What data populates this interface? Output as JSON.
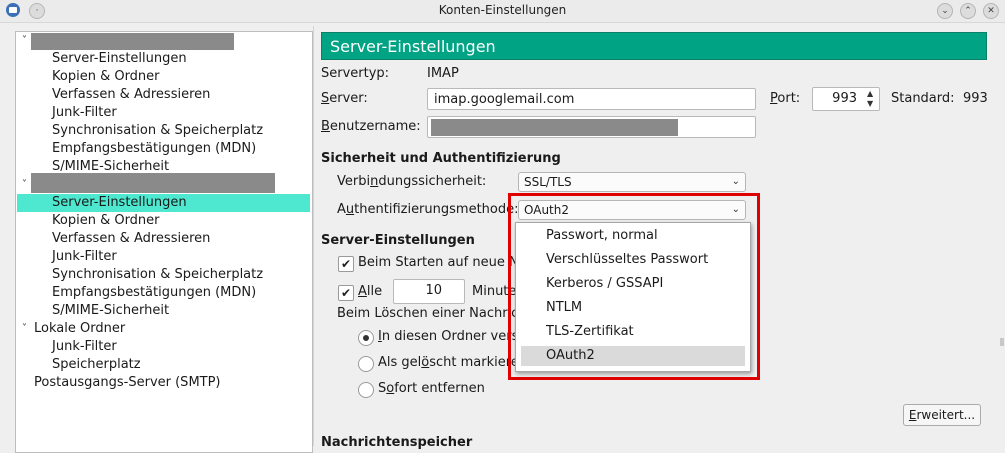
{
  "window": {
    "title": "Konten-Einstellungen",
    "buttons": {
      "minimize": "–",
      "maximize": "⌃",
      "close": "✕"
    }
  },
  "tree": {
    "account1": {
      "expanded_icon": "˅",
      "items": [
        "Server-Einstellungen",
        "Kopien & Ordner",
        "Verfassen & Adressieren",
        "Junk-Filter",
        "Synchronisation & Speicherplatz",
        "Empfangsbestätigungen (MDN)",
        "S/MIME-Sicherheit"
      ]
    },
    "account2": {
      "expanded_icon": "˅",
      "items": [
        "Server-Einstellungen",
        "Kopien & Ordner",
        "Verfassen & Adressieren",
        "Junk-Filter",
        "Synchronisation & Speicherplatz",
        "Empfangsbestätigungen (MDN)",
        "S/MIME-Sicherheit"
      ]
    },
    "local": {
      "label": "Lokale Ordner",
      "expanded_icon": "˅",
      "items": [
        "Junk-Filter",
        "Speicherplatz"
      ]
    },
    "smtp": "Postausgangs-Server (SMTP)"
  },
  "panel": {
    "header": "Server-Einstellungen",
    "servertype_label": "Servertyp:",
    "servertype_value": "IMAP",
    "server_label_u": "S",
    "server_label_rest": "erver:",
    "server_value": "imap.googlemail.com",
    "port_label_u": "P",
    "port_label_rest": "ort:",
    "port_value": "993",
    "standard_label": "Standard:",
    "standard_value": "993",
    "username_label_u": "B",
    "username_label_rest": "enutzername:",
    "security_heading": "Sicherheit und Authentifizierung",
    "conn_label_a": "Verbi",
    "conn_label_u": "n",
    "conn_label_b": "dungssicherheit:",
    "conn_value": "SSL/TLS",
    "auth_label_a": "A",
    "auth_label_u": "u",
    "auth_label_b": "thentifizierungsmethode:",
    "auth_value": "OAuth2",
    "server_settings_heading": "Server-Einstellungen",
    "check_startup": "Beim Starten auf neue Na",
    "check_every_u": "A",
    "check_every_rest": "lle",
    "check_every_value": "10",
    "minutes_label": "Minuter",
    "on_delete_label": "Beim Löschen einer Nachrich",
    "radio1_u": "I",
    "radio1_rest": "n diesen Ordner versc",
    "radio2_a": "Als gel",
    "radio2_u": "ö",
    "radio2_b": "scht markierer",
    "radio3_a": "S",
    "radio3_u": "o",
    "radio3_b": "fort entfernen",
    "advanced_button_u": "E",
    "advanced_button_rest": "rweitert...",
    "cut_heading": "Nachrichtenspeicher"
  },
  "dropdown": {
    "options": [
      "Passwort, normal",
      "Verschlüsseltes Passwort",
      "Kerberos / GSSAPI",
      "NTLM",
      "TLS-Zertifikat",
      "OAuth2"
    ],
    "highlighted": "OAuth2"
  },
  "icons": {
    "combo_arrow": "⌵",
    "check_mark": "✔",
    "spin_up": "▲",
    "spin_down": "▼"
  },
  "colors": {
    "header_bg": "#00a383",
    "selection": "#4de8cf",
    "highlight_frame": "#e00000"
  }
}
